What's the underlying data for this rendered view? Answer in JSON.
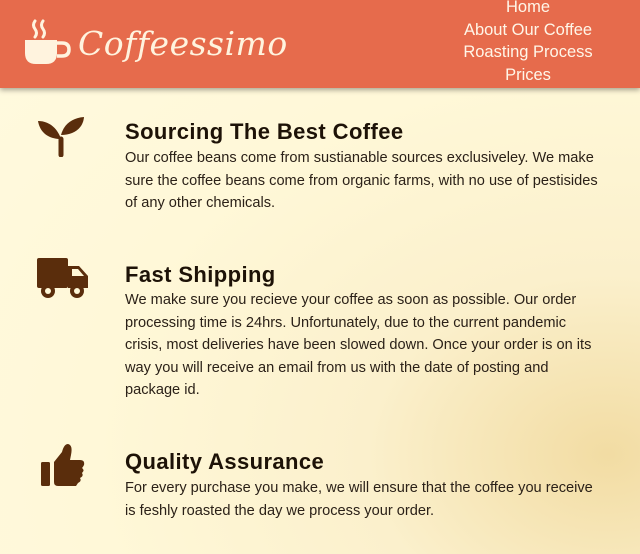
{
  "brand": {
    "logo_icon": "coffee-cup-icon",
    "name": "Coffeessimo"
  },
  "nav": {
    "items": [
      {
        "label": "Home"
      },
      {
        "label": "About Our Coffee"
      },
      {
        "label": "Roasting Process"
      },
      {
        "label": "Prices"
      }
    ]
  },
  "features": [
    {
      "icon": "sprout-icon",
      "title": "Sourcing The Best Coffee",
      "lines": [
        "Our coffee beans come from sustianable sources exclusiveley. We make",
        "sure the coffee beans come from organic farms, with no use of pestisides",
        "of any other chemicals."
      ]
    },
    {
      "icon": "truck-icon",
      "title": "Fast Shipping",
      "lines": [
        "We make sure you recieve your coffee as soon as possible. Our order",
        "processing time is 24hrs. Unfortunately, due to the current pandemic",
        "crisis, most deliveries have been slowed down. Once your order is on its",
        "way you will receive an email from us with the date of posting and",
        "package id."
      ]
    },
    {
      "icon": "thumbs-up-icon",
      "title": "Quality Assurance",
      "lines": [
        "For every purchase you make, we will ensure that the coffee you receive",
        "is feshly roasted the day we process your order."
      ]
    }
  ],
  "colors": {
    "header": "#e66b4c",
    "icon": "#5a2d0c",
    "background": "#fff8d8"
  }
}
